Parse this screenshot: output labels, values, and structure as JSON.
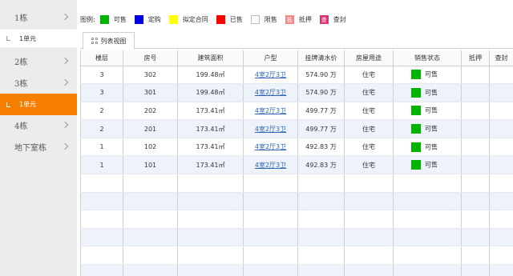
{
  "sidebar": {
    "buildings": [
      {
        "label": "1栋"
      },
      {
        "label": "2栋"
      },
      {
        "label": "3栋"
      },
      {
        "label": "4栋"
      },
      {
        "label": "地下室栋"
      }
    ],
    "units": [
      {
        "label": "1单元",
        "active": false
      },
      {
        "label": "1单元",
        "active": true
      }
    ]
  },
  "legend": {
    "label": "图例:",
    "items": [
      {
        "name": "可售",
        "color": "#00b400"
      },
      {
        "name": "定购",
        "color": "#0000e6"
      },
      {
        "name": "拟定合同",
        "color": "#ffff00"
      },
      {
        "name": "已售",
        "color": "#ff0000"
      },
      {
        "name": "限售",
        "color": "#ffffff"
      },
      {
        "name": "抵押",
        "color": "#f28a8a",
        "badge": "抵"
      },
      {
        "name": "查封",
        "color": "#e0317a",
        "badge": "查"
      }
    ]
  },
  "tab": {
    "label": "列表视图"
  },
  "table": {
    "headers": [
      "楼层",
      "房号",
      "建筑面积",
      "户型",
      "挂牌清水价",
      "房屋用途",
      "销售状态",
      "抵押",
      "查封"
    ],
    "rows": [
      {
        "floor": "3",
        "room": "302",
        "area": "199.48㎡",
        "type": "4室2厅3卫",
        "price": "574.90 万",
        "usage": "住宅",
        "status": "可售"
      },
      {
        "floor": "3",
        "room": "301",
        "area": "199.48㎡",
        "type": "4室2厅3卫",
        "price": "574.90 万",
        "usage": "住宅",
        "status": "可售"
      },
      {
        "floor": "2",
        "room": "202",
        "area": "173.41㎡",
        "type": "4室2厅3卫",
        "price": "499.77 万",
        "usage": "住宅",
        "status": "可售"
      },
      {
        "floor": "2",
        "room": "201",
        "area": "173.41㎡",
        "type": "4室2厅3卫",
        "price": "499.77 万",
        "usage": "住宅",
        "status": "可售"
      },
      {
        "floor": "1",
        "room": "102",
        "area": "173.41㎡",
        "type": "4室2厅3卫",
        "price": "492.83 万",
        "usage": "住宅",
        "status": "可售"
      },
      {
        "floor": "1",
        "room": "101",
        "area": "173.41㎡",
        "type": "4室2厅3卫",
        "price": "492.83 万",
        "usage": "住宅",
        "status": "可售"
      }
    ],
    "status_color": "#00b400"
  }
}
